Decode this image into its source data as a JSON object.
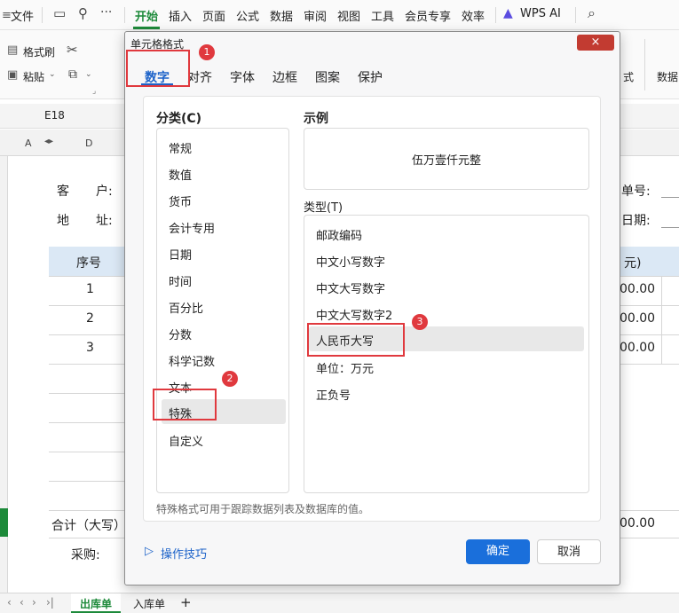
{
  "menubar": {
    "file": "文件",
    "tabs": [
      "开始",
      "插入",
      "页面",
      "公式",
      "数据",
      "审阅",
      "视图",
      "工具",
      "会员专享",
      "效率"
    ],
    "wps_ai": "WPS AI"
  },
  "ribbon": {
    "format_painter": "格式刷",
    "paste": "粘贴",
    "right_label": "数据",
    "partial_label": "式"
  },
  "name_box": "E18",
  "sheet": {
    "col_headers": [
      "A",
      "D"
    ],
    "customer_label": "客",
    "customer_label2": "户:",
    "address_label": "地",
    "address_label2": "址:",
    "order_no_label": "单号:",
    "date_label": "日期:",
    "seq_header": "序号",
    "amount_header": "元)",
    "rows": [
      "1",
      "2",
      "3"
    ],
    "amounts": [
      "00.00",
      "00.00",
      "00.00"
    ],
    "total_label": "合计（大写）",
    "total_amount": "00.00",
    "purchase_label": "采购:"
  },
  "sheet_tabs": [
    "出库单",
    "入库单"
  ],
  "dialog": {
    "title": "单元格格式",
    "close": "×",
    "tabs": [
      "数字",
      "对齐",
      "字体",
      "边框",
      "图案",
      "保护"
    ],
    "category_label": "分类(C)",
    "categories": [
      "常规",
      "数值",
      "货币",
      "会计专用",
      "日期",
      "时间",
      "百分比",
      "分数",
      "科学记数",
      "文本",
      "特殊",
      "自定义"
    ],
    "sample_label": "示例",
    "sample_value": "伍万壹仟元整",
    "type_label": "类型(T)",
    "types": [
      "邮政编码",
      "中文小写数字",
      "中文大写数字",
      "中文大写数字2",
      "人民币大写",
      "单位：万元",
      "正负号"
    ],
    "description": "特殊格式可用于跟踪数据列表及数据库的值。",
    "tips": "操作技巧",
    "ok": "确定",
    "cancel": "取消"
  },
  "markers": [
    "1",
    "2",
    "3"
  ],
  "colors": {
    "accent_green": "#1d8a3a",
    "accent_blue": "#1a6fdb",
    "annotation_red": "#e0393e",
    "close_red": "#c23b31"
  }
}
